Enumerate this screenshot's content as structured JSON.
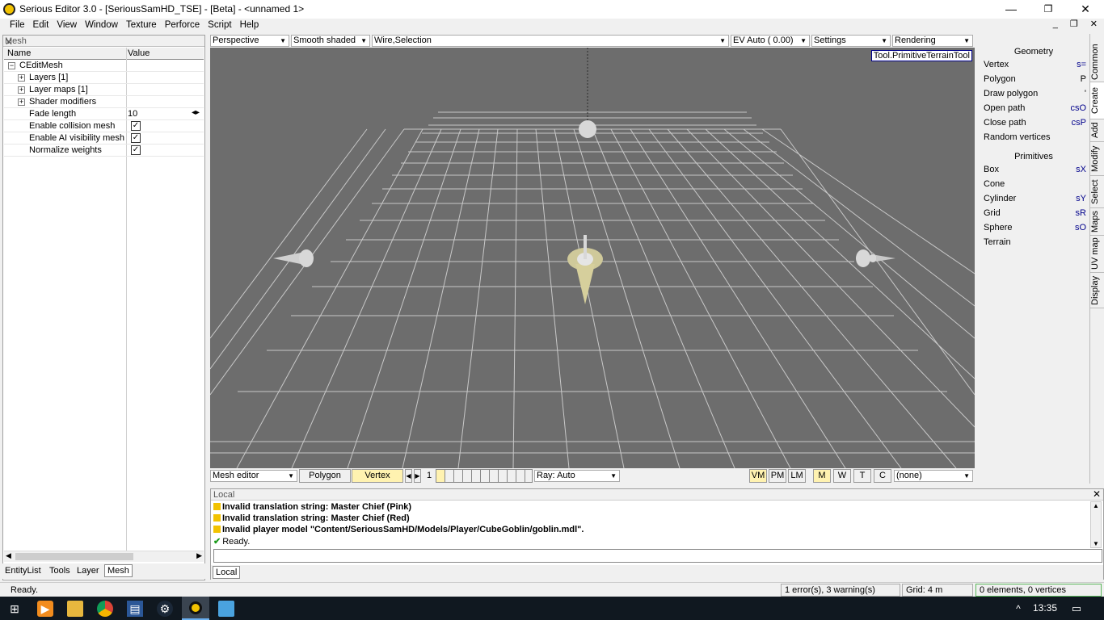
{
  "window": {
    "title": "Serious Editor 3.0 - [SeriousSamHD_TSE] - [Beta] - <unnamed 1>",
    "minimize": "—",
    "restore": "❐",
    "close": "✕"
  },
  "menu": [
    "File",
    "Edit",
    "View",
    "Window",
    "Texture",
    "Perforce",
    "Script",
    "Help"
  ],
  "menu_right": "_ ❐ ✕",
  "left_panel": {
    "title": "Mesh",
    "close": "✕",
    "col_name": "Name",
    "col_value": "Value",
    "rows": [
      {
        "name": "CEditMesh",
        "value": ""
      },
      {
        "name": "Layers [1]",
        "value": ""
      },
      {
        "name": "Layer maps [1]",
        "value": ""
      },
      {
        "name": "Shader modifiers",
        "value": ""
      },
      {
        "name": "Fade length",
        "value": "10"
      },
      {
        "name": "Enable collision mesh",
        "value": "✓"
      },
      {
        "name": "Enable AI visibility mesh",
        "value": "✓"
      },
      {
        "name": "Normalize weights",
        "value": "✓"
      }
    ],
    "tabs": [
      "EntityList",
      "Tools",
      "Layer",
      "Mesh"
    ],
    "active_tab": "Mesh"
  },
  "viewport": {
    "toolbar": {
      "projection": "Perspective",
      "shading": "Smooth shaded",
      "overlay": "Wire,Selection",
      "exposure": "EV Auto ( 0.00)",
      "settings": "Settings",
      "rendering": "Rendering"
    },
    "tooltip": "Tool.PrimitiveTerrainTool",
    "bottom": {
      "mode": "Mesh editor",
      "polygon": "Polygon",
      "vertex": "Vertex",
      "counter": "1",
      "ray": "Ray: Auto",
      "vm": "VM",
      "pm": "PM",
      "lm": "LM",
      "m": "M",
      "w": "W",
      "t": "T",
      "c": "C",
      "none": "(none)"
    }
  },
  "right_panel": {
    "geometry_title": "Geometry",
    "geometry": [
      {
        "label": "Vertex",
        "key": "s="
      },
      {
        "label": "Polygon",
        "key": "P"
      },
      {
        "label": "Draw polygon",
        "key": "'"
      },
      {
        "label": "Open path",
        "key": "csO"
      },
      {
        "label": "Close path",
        "key": "csP"
      },
      {
        "label": "Random vertices",
        "key": ""
      }
    ],
    "primitives_title": "Primitives",
    "primitives": [
      {
        "label": "Box",
        "key": "sX"
      },
      {
        "label": "Cone",
        "key": ""
      },
      {
        "label": "Cylinder",
        "key": "sY"
      },
      {
        "label": "Grid",
        "key": "sR"
      },
      {
        "label": "Sphere",
        "key": "sO"
      },
      {
        "label": "Terrain",
        "key": ""
      }
    ],
    "tabs": [
      "Common",
      "Create",
      "Add",
      "Modify",
      "Select",
      "Maps",
      "UV map",
      "Display"
    ]
  },
  "log": {
    "title": "Local",
    "lines": [
      {
        "type": "warn",
        "text": "Invalid translation string: Master Chief (Pink)"
      },
      {
        "type": "warn",
        "text": "Invalid translation string: Master Chief (Red)"
      },
      {
        "type": "warn",
        "text": "Invalid player model \"Content/SeriousSamHD/Models/Player/CubeGoblin/goblin.mdl\"."
      },
      {
        "type": "ok",
        "text": "Ready."
      }
    ],
    "tab": "Local"
  },
  "status": {
    "left": "Ready.",
    "errors": "1 error(s), 3 warning(s)",
    "grid": "Grid: 4 m",
    "selection": "0 elements, 0 vertices"
  },
  "taskbar": {
    "time": "13:35"
  },
  "colors": {
    "viewport_bg": "#6d6d6d",
    "grid_line": "#c8c8c8",
    "selected_btn": "#fff2b0",
    "taskbar": "#101820"
  }
}
